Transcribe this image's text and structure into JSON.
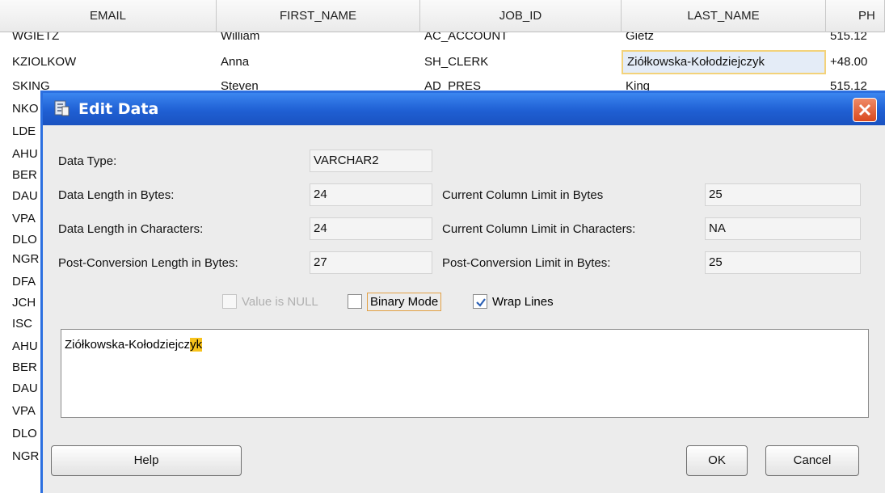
{
  "grid": {
    "columns": [
      "EMAIL",
      "FIRST_NAME",
      "JOB_ID",
      "LAST_NAME",
      "PH"
    ],
    "rows": [
      [
        "WGIETZ",
        "William",
        "AC_ACCOUNT",
        "Gietz",
        "515.12"
      ],
      [
        "KZIOLKOW",
        "Anna",
        "SH_CLERK",
        "Ziółkowska-Kołodziejczyk",
        "+48.00"
      ],
      [
        "SKING",
        "Steven",
        "AD_PRES",
        "King",
        "515.12"
      ]
    ],
    "partial_emails": [
      "NKO",
      "LDE",
      "AHU",
      "BER",
      "DAU",
      "VPA",
      "DLO",
      "NGR",
      "DFA",
      "JCH",
      "ISC",
      "AHU",
      "BER",
      "DAU",
      "VPA",
      "DLO",
      "NGR"
    ]
  },
  "dialog": {
    "title": "Edit Data",
    "left": {
      "data_type_label": "Data Type:",
      "data_type_value": "VARCHAR2",
      "len_bytes_label": "Data Length in Bytes:",
      "len_bytes_value": "24",
      "len_chars_label": "Data Length in Characters:",
      "len_chars_value": "24",
      "post_len_label": "Post-Conversion Length in Bytes:",
      "post_len_value": "27"
    },
    "right": {
      "col_limit_bytes_label": "Current Column Limit in Bytes",
      "col_limit_bytes_value": "25",
      "col_limit_chars_label": "Current Column Limit in Characters:",
      "col_limit_chars_value": "NA",
      "post_limit_label": "Post-Conversion Limit in Bytes:",
      "post_limit_value": "25"
    },
    "options": {
      "value_is_null": "Value is NULL",
      "binary_mode": "Binary Mode",
      "wrap_lines": "Wrap Lines"
    },
    "text": {
      "value_main": "Ziółkowska-Kołodziejcz",
      "value_overflow": "yk"
    },
    "buttons": {
      "help": "Help",
      "ok": "OK",
      "cancel": "Cancel"
    }
  },
  "colors": {
    "titlebar": "#1f5fd3",
    "highlight": "#f7c21c",
    "close": "#d9491f"
  }
}
